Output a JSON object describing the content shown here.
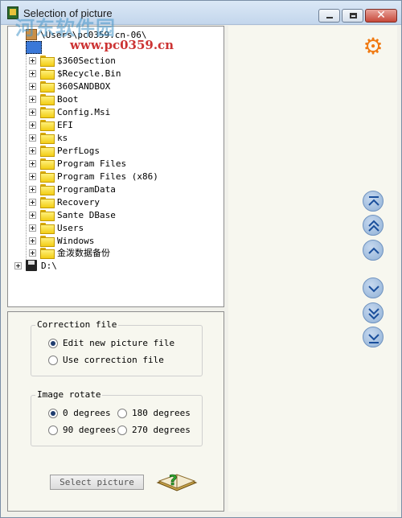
{
  "window": {
    "title": "Selection of picture",
    "watermark": "河东软件园",
    "watermark_url": "www.pc0359.cn"
  },
  "tree": {
    "root_label": "\\Users\\pc0359.cn-06\\",
    "items": [
      {
        "label": "$360Section"
      },
      {
        "label": "$Recycle.Bin"
      },
      {
        "label": "360SANDBOX"
      },
      {
        "label": "Boot"
      },
      {
        "label": "Config.Msi"
      },
      {
        "label": "EFI"
      },
      {
        "label": "ks"
      },
      {
        "label": "PerfLogs"
      },
      {
        "label": "Program Files"
      },
      {
        "label": "Program Files (x86)"
      },
      {
        "label": "ProgramData"
      },
      {
        "label": "Recovery"
      },
      {
        "label": "Sante DBase"
      },
      {
        "label": "Users"
      },
      {
        "label": "Windows"
      },
      {
        "label": "金泼数据备份"
      }
    ],
    "drive_d": "D:\\"
  },
  "correction": {
    "title": "Correction file",
    "options": [
      "Edit new picture file",
      "Use correction file"
    ],
    "selected": "Edit new picture file"
  },
  "rotate": {
    "title": "Image rotate",
    "options": [
      "0 degrees",
      "180 degrees",
      "90 degrees",
      "270 degrees"
    ],
    "selected": "0 degrees"
  },
  "select_button_label": "Select picture",
  "icons": {
    "gear": "gear-icon",
    "nav": [
      "first-page-icon",
      "double-up-icon",
      "up-icon",
      "down-icon",
      "double-down-icon",
      "last-page-icon"
    ]
  },
  "colors": {
    "accent": "#f07a12",
    "nav_button": "#8fb0d6",
    "selection": "#3a78d8"
  }
}
